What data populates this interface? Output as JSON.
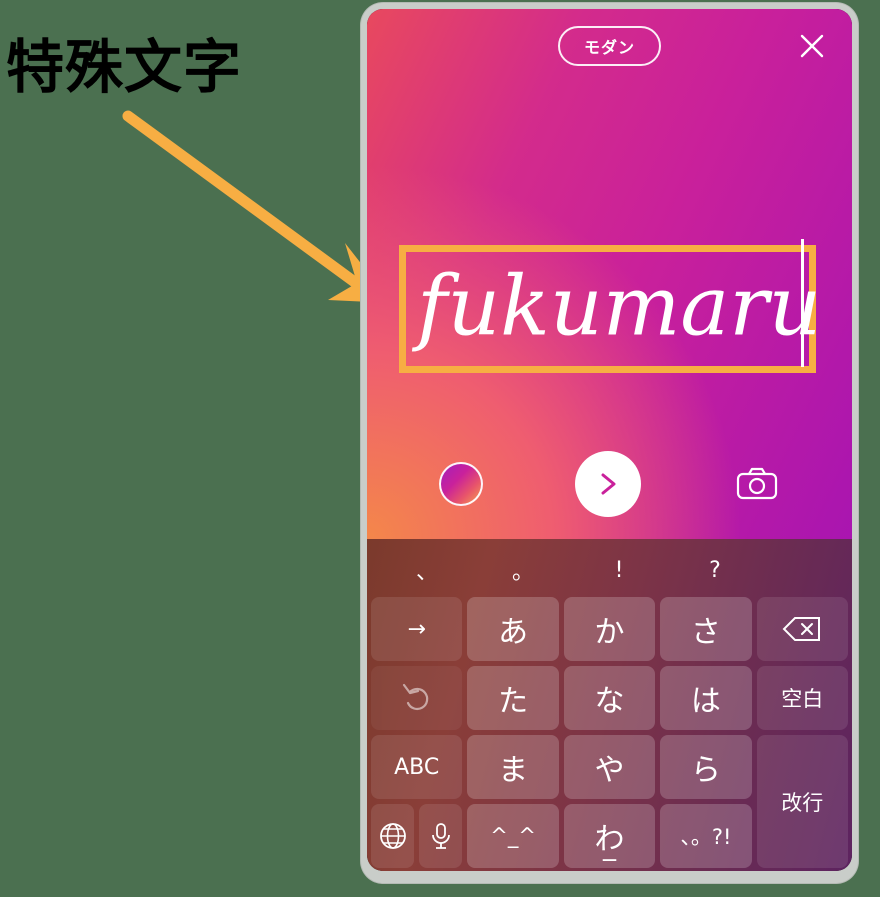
{
  "annotation": {
    "label": "特殊文字",
    "label_color": "#000000",
    "arrow_color": "#f7ae43"
  },
  "page": {
    "background_color": "#4b7050"
  },
  "story": {
    "style_pill_label": "モダン",
    "close_icon": "close-icon",
    "text_value": "fukumaru",
    "highlight_color": "#f7ae43",
    "gradient_from": "#f4874a",
    "gradient_to": "#a915b0",
    "controls": {
      "color_picker": "color-picker-icon",
      "next": "chevron-right-icon",
      "camera": "camera-icon"
    }
  },
  "keyboard": {
    "suggestions": [
      "、",
      "。",
      "!",
      "?"
    ],
    "rows": [
      [
        {
          "label": "→",
          "name": "key-arrow-right",
          "type": "func"
        },
        {
          "label": "あ",
          "name": "key-a",
          "type": "kana"
        },
        {
          "label": "か",
          "name": "key-ka",
          "type": "kana"
        },
        {
          "label": "さ",
          "name": "key-sa",
          "type": "kana"
        },
        {
          "label": "⌫",
          "name": "key-backspace",
          "type": "func"
        }
      ],
      [
        {
          "label": "↺",
          "name": "key-undo",
          "type": "func"
        },
        {
          "label": "た",
          "name": "key-ta",
          "type": "kana"
        },
        {
          "label": "な",
          "name": "key-na",
          "type": "kana"
        },
        {
          "label": "は",
          "name": "key-ha",
          "type": "kana"
        },
        {
          "label": "空白",
          "name": "key-space",
          "type": "func"
        }
      ],
      [
        {
          "label": "ABC",
          "name": "key-abc",
          "type": "func"
        },
        {
          "label": "ま",
          "name": "key-ma",
          "type": "kana"
        },
        {
          "label": "や",
          "name": "key-ya",
          "type": "kana"
        },
        {
          "label": "ら",
          "name": "key-ra",
          "type": "kana"
        },
        {
          "label": "改行",
          "name": "key-return",
          "type": "func"
        }
      ],
      [
        {
          "label": "globe",
          "name": "key-globe",
          "type": "func"
        },
        {
          "label": "mic",
          "name": "key-mic",
          "type": "func"
        },
        {
          "label": "^_^",
          "name": "key-emoticon",
          "type": "kana"
        },
        {
          "label": "わ",
          "sub": "_",
          "name": "key-wa",
          "type": "kana"
        },
        {
          "label": "、。?!",
          "name": "key-punctuation",
          "type": "kana"
        }
      ]
    ],
    "labels": {
      "arrow_right": "→",
      "undo": "↺",
      "abc": "ABC",
      "space": "空白",
      "return": "改行",
      "emoticon": "^_^",
      "wa": "わ",
      "wa_sub": "_",
      "punctuation": "、。?!",
      "a": "あ",
      "ka": "か",
      "sa": "さ",
      "ta": "た",
      "na": "な",
      "ha": "は",
      "ma": "ま",
      "ya": "や",
      "ra": "ら"
    }
  }
}
